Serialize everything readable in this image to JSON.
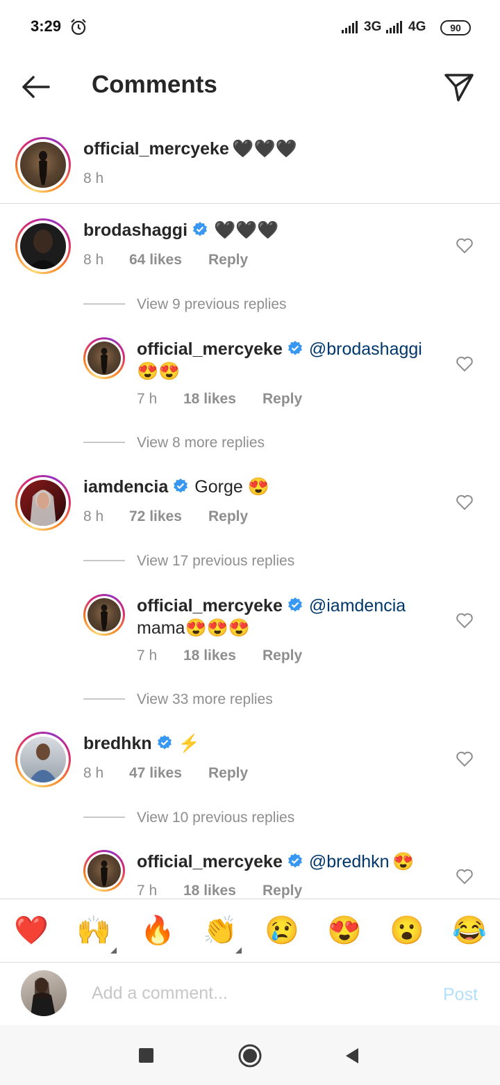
{
  "status_bar": {
    "time": "3:29",
    "net1": "3G",
    "net2": "4G",
    "battery": "90"
  },
  "header": {
    "title": "Comments"
  },
  "caption": {
    "username": "official_mercyeke",
    "text": "🖤🖤🖤",
    "time": "8 h"
  },
  "threads": [
    {
      "username": "brodashaggi",
      "text": "🖤🖤🖤",
      "time": "8 h",
      "likes": "64 likes",
      "reply": "Reply",
      "view_prev": "View 9 previous replies",
      "reply_item": {
        "username": "official_mercyeke",
        "mention": "@brodashaggi",
        "text": "😍😍",
        "time": "7 h",
        "likes": "18 likes",
        "reply": "Reply"
      },
      "view_more": "View 8 more replies"
    },
    {
      "username": "iamdencia",
      "text": "Gorge 😍",
      "time": "8 h",
      "likes": "72 likes",
      "reply": "Reply",
      "view_prev": "View 17 previous replies",
      "reply_item": {
        "username": "official_mercyeke",
        "mention": "@iamdencia",
        "text": "mama😍😍😍",
        "time": "7 h",
        "likes": "18 likes",
        "reply": "Reply"
      },
      "view_more": "View 33 more replies"
    },
    {
      "username": "bredhkn",
      "text": "⚡",
      "time": "8 h",
      "likes": "47 likes",
      "reply": "Reply",
      "view_prev": "View 10 previous replies",
      "reply_item": {
        "username": "official_mercyeke",
        "mention": "@bredhkn",
        "text": "😍",
        "time": "7 h",
        "likes": "18 likes",
        "reply": "Reply"
      }
    }
  ],
  "emoji_bar": [
    "❤️",
    "🙌",
    "🔥",
    "👏",
    "😢",
    "😍",
    "😮",
    "😂"
  ],
  "composer": {
    "placeholder": "Add a comment...",
    "post": "Post"
  },
  "colors": {
    "mention": "#00376b",
    "verified": "#3897f0",
    "secondary": "#8e8e8e",
    "post_disabled": "#b2dffc"
  }
}
